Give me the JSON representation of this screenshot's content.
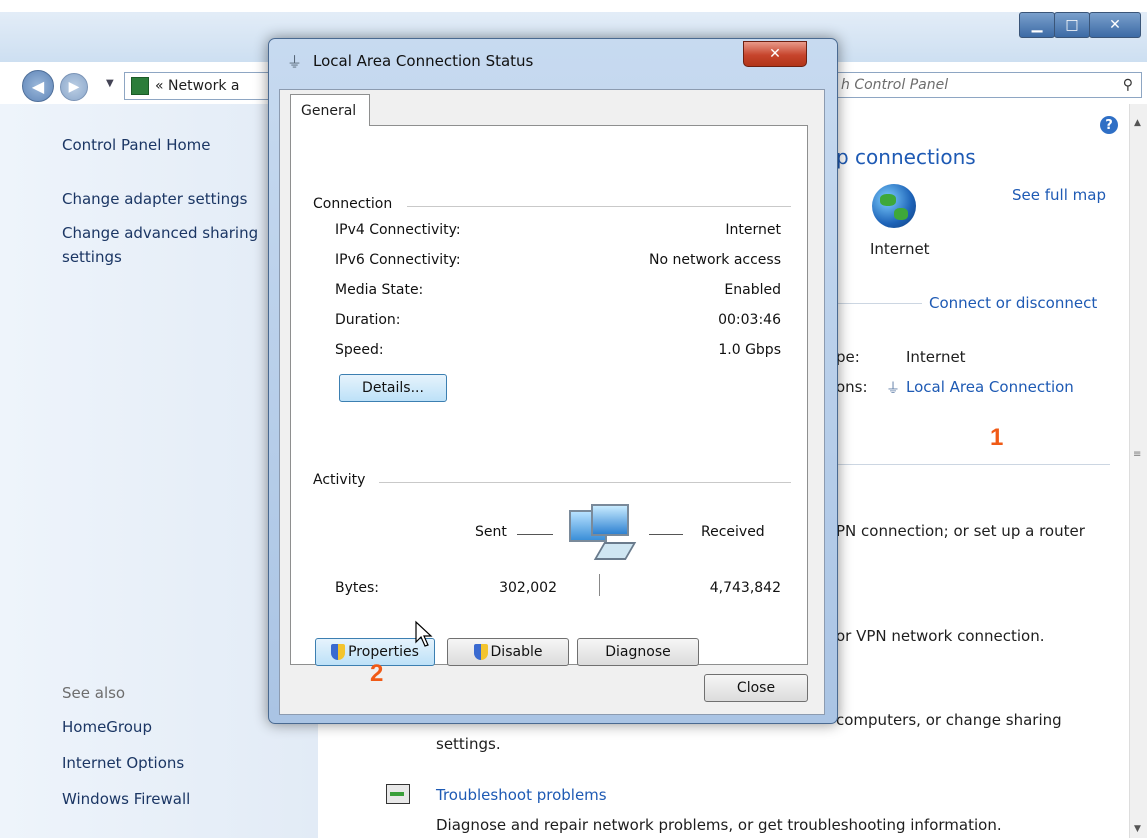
{
  "explorer": {
    "address": "« Network a",
    "search_placeholder": "h Control Panel",
    "left_nav": {
      "home": "Control Panel Home",
      "adapter": "Change adapter settings",
      "sharing_line1": "Change advanced sharing",
      "sharing_line2": "settings",
      "see_also": "See also",
      "homegroup": "HomeGroup",
      "internet_options": "Internet Options",
      "firewall": "Windows Firewall"
    },
    "content": {
      "heading": "p connections",
      "see_full_map": "See full map",
      "internet_label": "Internet",
      "connect_disconnect": "Connect or disconnect",
      "access_type_label": "pe:",
      "access_type_value": "Internet",
      "connections_label": "ons:",
      "connections_value": "Local Area Connection",
      "vpn_text": "PN connection; or set up a router",
      "vpn_text2": "or VPN network connection.",
      "computers_text": "computers, or change sharing",
      "settings_text": "settings.",
      "troubleshoot_link": "Troubleshoot problems",
      "troubleshoot_desc": "Diagnose and repair network problems, or get troubleshooting information."
    }
  },
  "dialog": {
    "title": "Local Area Connection Status",
    "tab": "General",
    "connection_group": "Connection",
    "rows": [
      {
        "label": "IPv4 Connectivity:",
        "value": "Internet"
      },
      {
        "label": "IPv6 Connectivity:",
        "value": "No network access"
      },
      {
        "label": "Media State:",
        "value": "Enabled"
      },
      {
        "label": "Duration:",
        "value": "00:03:46"
      },
      {
        "label": "Speed:",
        "value": "1.0 Gbps"
      }
    ],
    "details_button": "Details...",
    "activity_group": "Activity",
    "sent_label": "Sent",
    "received_label": "Received",
    "bytes_label": "Bytes:",
    "bytes_sent": "302,002",
    "bytes_received": "4,743,842",
    "properties_button": "Properties",
    "disable_button": "Disable",
    "diagnose_button": "Diagnose",
    "close_button": "Close"
  },
  "markers": {
    "one": "1",
    "two": "2"
  },
  "colors": {
    "marker": "#f05a16",
    "link": "#1e5ab4",
    "nav_link": "#1b3664"
  }
}
